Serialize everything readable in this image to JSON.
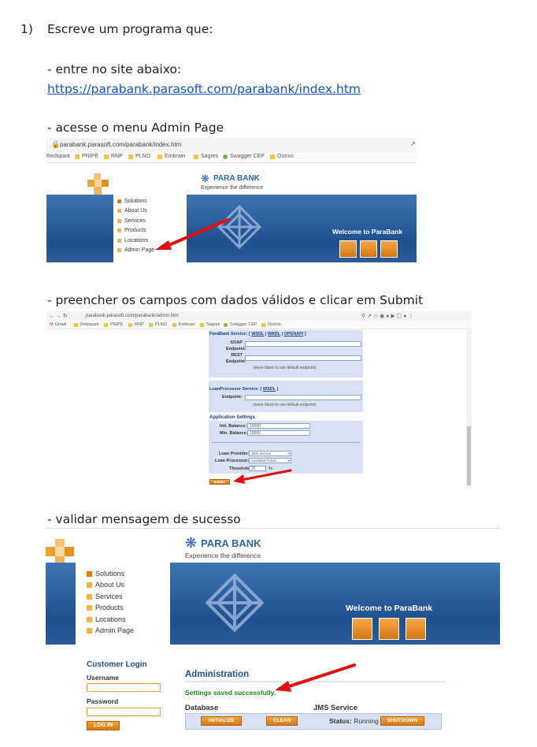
{
  "doc": {
    "step_number": "1)",
    "step_title": "Escreve um programa que:",
    "line_enter": "- entre no site abaixo:",
    "url": "https://parabank.parasoft.com/parabank/index.htm",
    "line_menu": "- acesse o menu Admin Page",
    "line_fill": "- preencher os campos com dados válidos e clicar em Submit",
    "line_validate": "- validar mensagem de sucesso"
  },
  "shot1": {
    "address": "parabank.parasoft.com/parabank/index.htm",
    "bookmarks": [
      "Redspark",
      "PNIPE",
      "RNP",
      "PLNO",
      "Embraer",
      "Sagres",
      "Swagger CEP",
      "Outros"
    ],
    "brand": "PARA BANK",
    "tagline": "Experience the difference",
    "menu": [
      "Solutions",
      "About Us",
      "Services",
      "Products",
      "Locations",
      "Admin Page"
    ],
    "welcome": "Welcome to ParaBank"
  },
  "shot2": {
    "address": "parabank.parasoft.com/parabank/admin.htm",
    "bookmarks": [
      "Gmail",
      "Redspark",
      "PNIPE",
      "RNP",
      "PLNO",
      "Embraer",
      "Sagres",
      "Swagger CEP",
      "Outros"
    ],
    "parabank_service": "ParaBank Service:",
    "wsdl": "WSDL",
    "wadl": "WADL",
    "openapi": "OPENAPI",
    "soap_label": "SOAP Endpoint:",
    "rest_label": "REST Endpoint:",
    "hint1": "(leave blank to use default endpoint)",
    "loan_service": "LoanProcessor Service:",
    "endpoint_label": "Endpoint:",
    "hint2": "(leave blank to use default endpoint)",
    "app_settings": "Application Settings",
    "init_balance_label": "Init. Balance: $",
    "init_balance": "10000",
    "min_balance_label": "Min. Balance: $",
    "min_balance": "10000",
    "loan_provider_label": "Loan Provider:",
    "loan_provider": "Web Service",
    "loan_processor_label": "Loan Processor:",
    "loan_processor": "Available Funds",
    "threshold_label": "Threshold:",
    "threshold": "20",
    "percent": "%",
    "submit": "SUBMIT"
  },
  "shot3": {
    "brand": "PARA BANK",
    "tagline": "Experience the difference",
    "menu": [
      "Solutions",
      "About Us",
      "Services",
      "Products",
      "Locations",
      "Admin Page"
    ],
    "welcome": "Welcome to ParaBank",
    "customer_login": "Customer Login",
    "username": "Username",
    "password": "Password",
    "login": "LOG IN",
    "admin_title": "Administration",
    "success": "Settings saved successfully.",
    "database": "Database",
    "jms": "JMS Service",
    "initialize": "INITIALIZE",
    "clean": "CLEAN",
    "status_label": "Status:",
    "status_value": "Running",
    "shutdown": "SHUTDOWN"
  },
  "colors": {
    "accent_orange": "#e8901e",
    "brand_blue": "#1f4f8e",
    "arrow_red": "#e01010",
    "success_green": "#1a8a1a"
  }
}
